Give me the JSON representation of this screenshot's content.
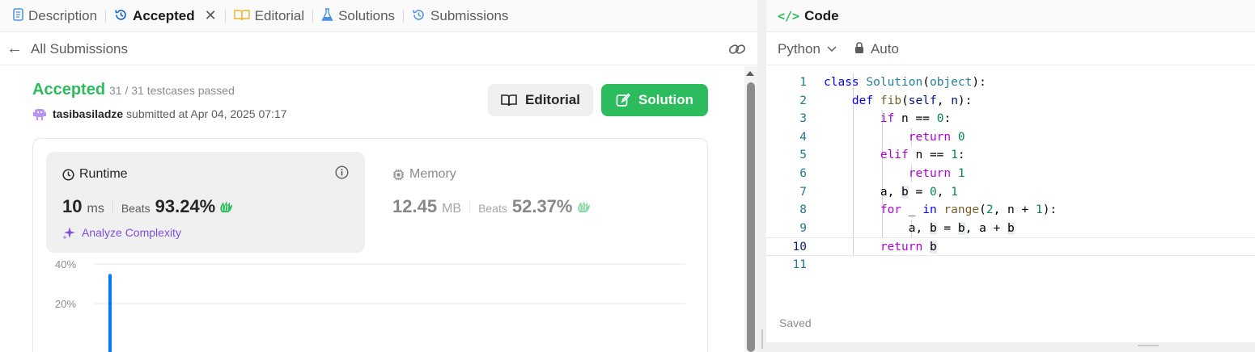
{
  "tabs": [
    {
      "label": "Description",
      "icon": "document-icon"
    },
    {
      "label": "Accepted",
      "icon": "history-icon",
      "active": true,
      "closable": true
    },
    {
      "label": "Editorial",
      "icon": "book-icon"
    },
    {
      "label": "Solutions",
      "icon": "flask-icon"
    },
    {
      "label": "Submissions",
      "icon": "history-icon"
    }
  ],
  "subheader": {
    "back_label": "All Submissions"
  },
  "result": {
    "status": "Accepted",
    "testcases": "31 / 31 testcases passed",
    "username": "tasibasiladze",
    "submitted_text": "submitted at Apr 04, 2025 07:17",
    "editorial_button": "Editorial",
    "solution_button": "Solution"
  },
  "runtime": {
    "title": "Runtime",
    "value": "10",
    "unit": "ms",
    "beats_label": "Beats",
    "beats_pct": "93.24%",
    "analyze_label": "Analyze Complexity"
  },
  "memory": {
    "title": "Memory",
    "value": "12.45",
    "unit": "MB",
    "beats_label": "Beats",
    "beats_pct": "52.37%"
  },
  "chart_data": {
    "type": "bar",
    "y_tick_labels": [
      "40%",
      "20%"
    ],
    "ylim": [
      0,
      40
    ],
    "bar_values": [
      35
    ]
  },
  "code_panel": {
    "title": "Code",
    "language": "Python",
    "mode": "Auto",
    "status": "Saved",
    "lines": [
      "class Solution(object):",
      "    def fib(self, n):",
      "        if n == 0:",
      "            return 0",
      "        elif n == 1:",
      "            return 1",
      "        a, b = 0, 1",
      "        for _ in range(2, n + 1):",
      "            a, b = b, a + b",
      "        return b",
      ""
    ],
    "current_line": 10
  },
  "colors": {
    "accent_green": "#2cbb5d",
    "chart_bar": "#007aff",
    "analyze_purple": "#7b4fdc"
  }
}
